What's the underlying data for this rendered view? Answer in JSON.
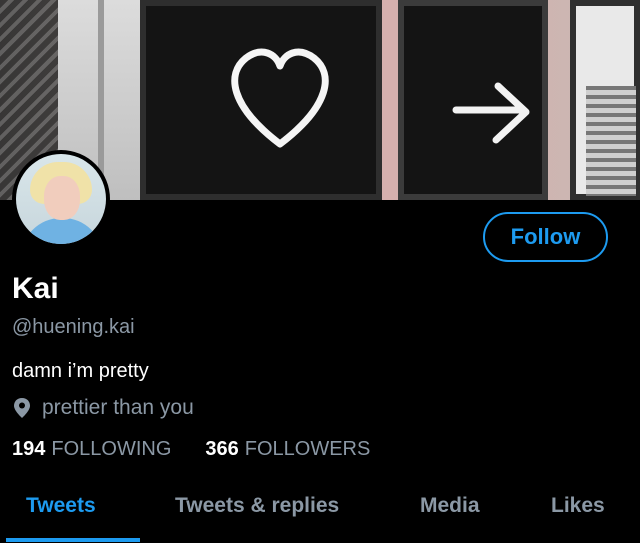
{
  "profile": {
    "name": "Kai",
    "handle": "@huening.kai",
    "bio": "damn i’m pretty",
    "location": "prettier than you",
    "follow_label": "Follow"
  },
  "stats": {
    "following_count": "194",
    "following_label": "FOLLOWING",
    "followers_count": "366",
    "followers_label": "FOLLOWERS"
  },
  "tabs": [
    {
      "label": "Tweets",
      "active": true
    },
    {
      "label": "Tweets & replies",
      "active": false
    },
    {
      "label": "Media",
      "active": false
    },
    {
      "label": "Likes",
      "active": false
    }
  ],
  "icons": {
    "location": "location-pin-icon",
    "banner_heart": "neon-heart",
    "banner_arrow": "neon-arrow"
  },
  "colors": {
    "accent": "#1d9bf0",
    "muted_text": "#8b98a5",
    "background": "#000000",
    "text": "#ffffff"
  }
}
